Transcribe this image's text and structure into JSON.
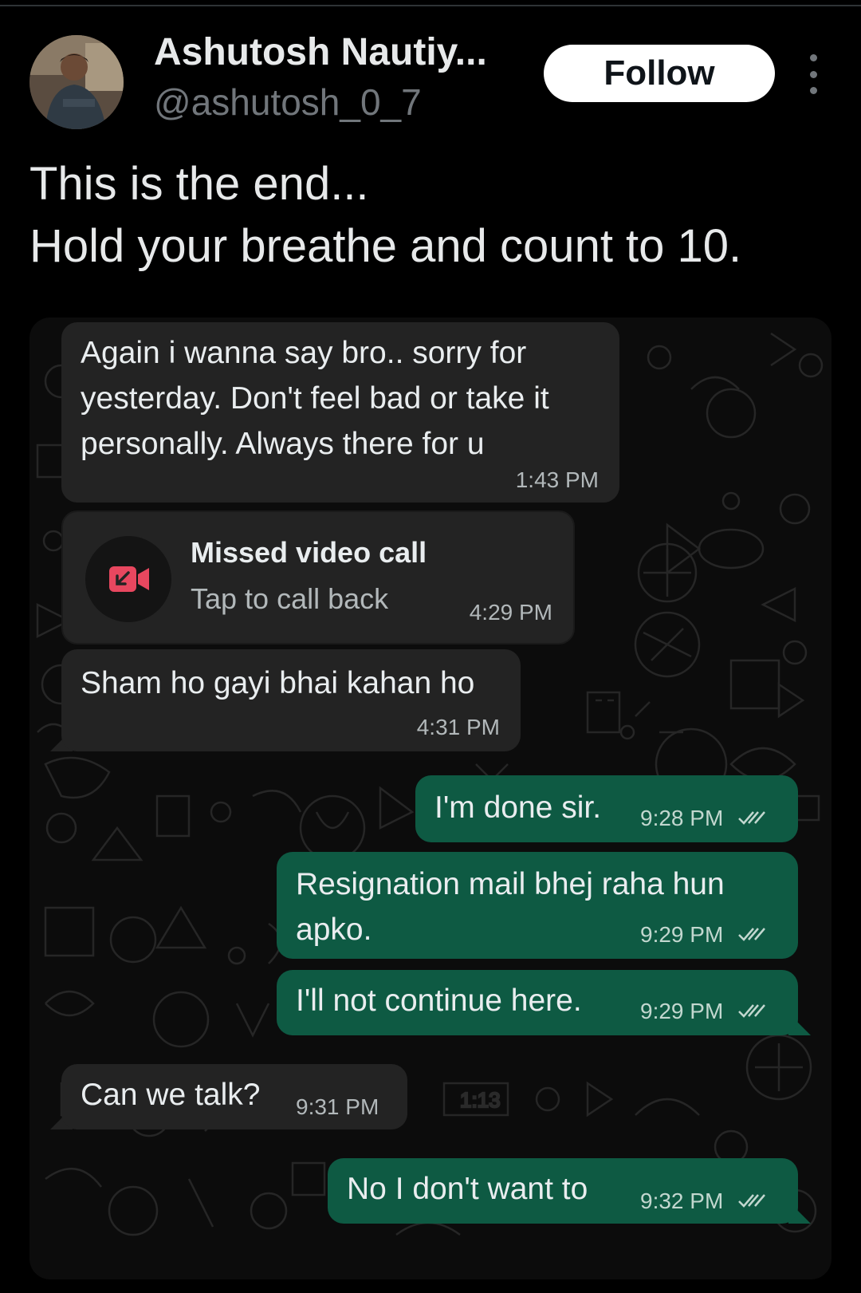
{
  "post": {
    "author_name": "Ashutosh Nautiy...",
    "author_handle": "@ashutosh_0_7",
    "follow_label": "Follow",
    "text_lines": [
      "This is the end...",
      "Hold your breathe and count to 10."
    ]
  },
  "chat": {
    "messages": [
      {
        "direction": "incoming",
        "lines": [
          "Again i wanna say bro.. sorry for",
          "yesterday. Don't feel bad or take it",
          "personally. Always there for u"
        ],
        "time": "1:43 PM"
      },
      {
        "direction": "incoming",
        "type": "missed-call",
        "title": "Missed video call",
        "subtitle": "Tap to call back",
        "time": "4:29 PM"
      },
      {
        "direction": "incoming",
        "lines": [
          "Sham ho gayi bhai kahan ho"
        ],
        "time": "4:31 PM"
      },
      {
        "direction": "outgoing",
        "lines": [
          "I'm done sir."
        ],
        "time": "9:28 PM"
      },
      {
        "direction": "outgoing",
        "lines": [
          "Resignation mail bhej raha hun",
          "apko."
        ],
        "time": "9:29 PM"
      },
      {
        "direction": "outgoing",
        "lines": [
          "I'll not continue here."
        ],
        "time": "9:29 PM"
      },
      {
        "direction": "incoming",
        "lines": [
          "Can we talk?"
        ],
        "time": "9:31 PM"
      },
      {
        "direction": "outgoing",
        "lines": [
          "No I don't want to"
        ],
        "time": "9:32 PM"
      }
    ]
  },
  "colors": {
    "background": "#000000",
    "incoming_bubble": "#232323",
    "outgoing_bubble": "#0e5a43",
    "missed_call_icon": "#e8475f"
  },
  "icons": [
    "more-options-icon",
    "missed-video-call-icon",
    "double-check-icon"
  ]
}
